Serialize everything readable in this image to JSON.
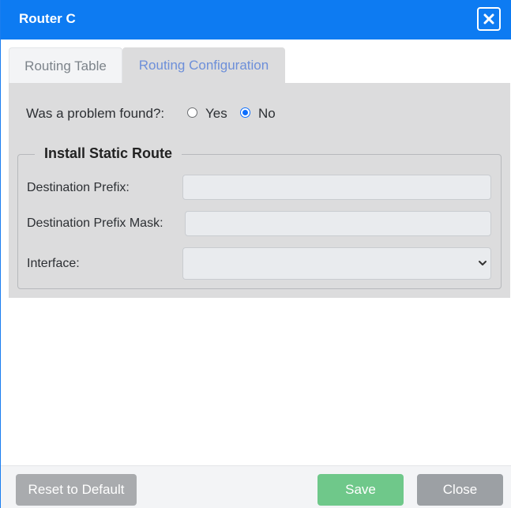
{
  "window": {
    "title": "Router C"
  },
  "tabs": [
    {
      "label": "Routing Table"
    },
    {
      "label": "Routing Configuration"
    }
  ],
  "problem": {
    "question": "Was a problem found?:",
    "options": [
      "Yes",
      "No"
    ],
    "selected": "No"
  },
  "static_route": {
    "legend": "Install Static Route",
    "destination_prefix": {
      "label": "Destination Prefix:",
      "value": ""
    },
    "destination_prefix_mask": {
      "label": "Destination Prefix Mask:",
      "value": ""
    },
    "interface": {
      "label": "Interface:",
      "selected": ""
    }
  },
  "footer": {
    "reset_label": "Reset to Default",
    "save_label": "Save",
    "close_label": "Close"
  },
  "colors": {
    "titlebar": "#0d7bf2",
    "panel": "#dcdcdd",
    "save": "#6fc88a",
    "close": "#9ca0a4",
    "reset": "#a9abae"
  }
}
